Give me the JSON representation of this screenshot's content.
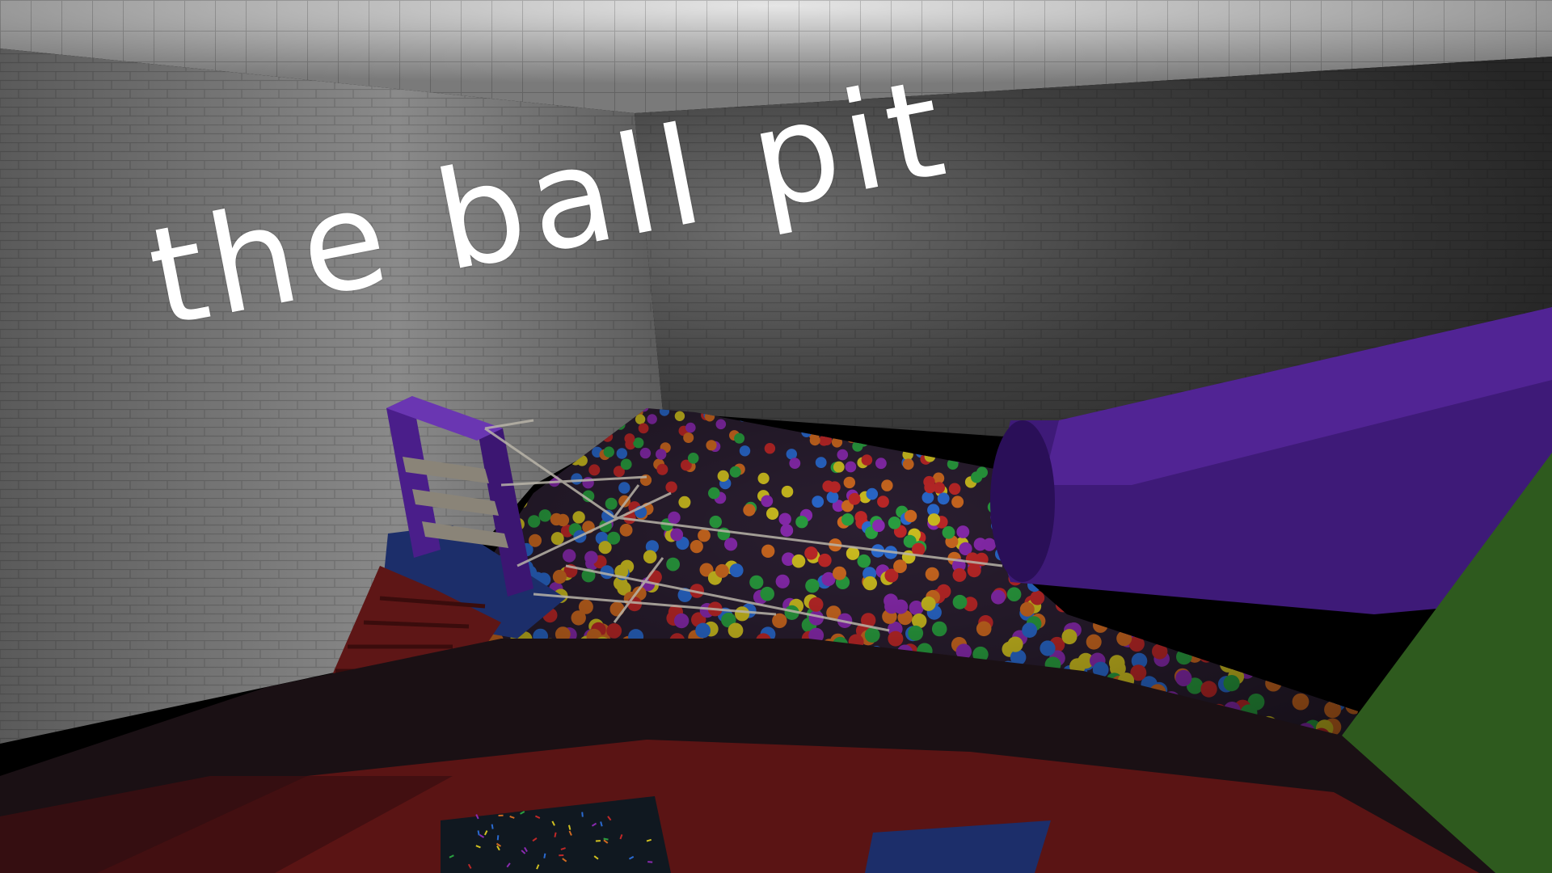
{
  "caption": {
    "text": "the ball pit"
  },
  "scene": {
    "palette": {
      "ceiling": "#9c9c9c",
      "left_wall": "#6a6a6a",
      "back_wall": "#3a3a3a",
      "floor_dark": "#1a1014",
      "ledge_red": "#7a1818",
      "slide_purple": "#3e1a78",
      "frame_purple": "#4a1e8a",
      "stairs_red": "#6a1a1a",
      "green_panel": "#2e5a1e",
      "blue_mat": "#1c2e6a",
      "ball_colors": [
        "#c02828",
        "#2a6ad0",
        "#2aa040",
        "#d0c020",
        "#8a2ab0",
        "#d06a20"
      ]
    }
  }
}
